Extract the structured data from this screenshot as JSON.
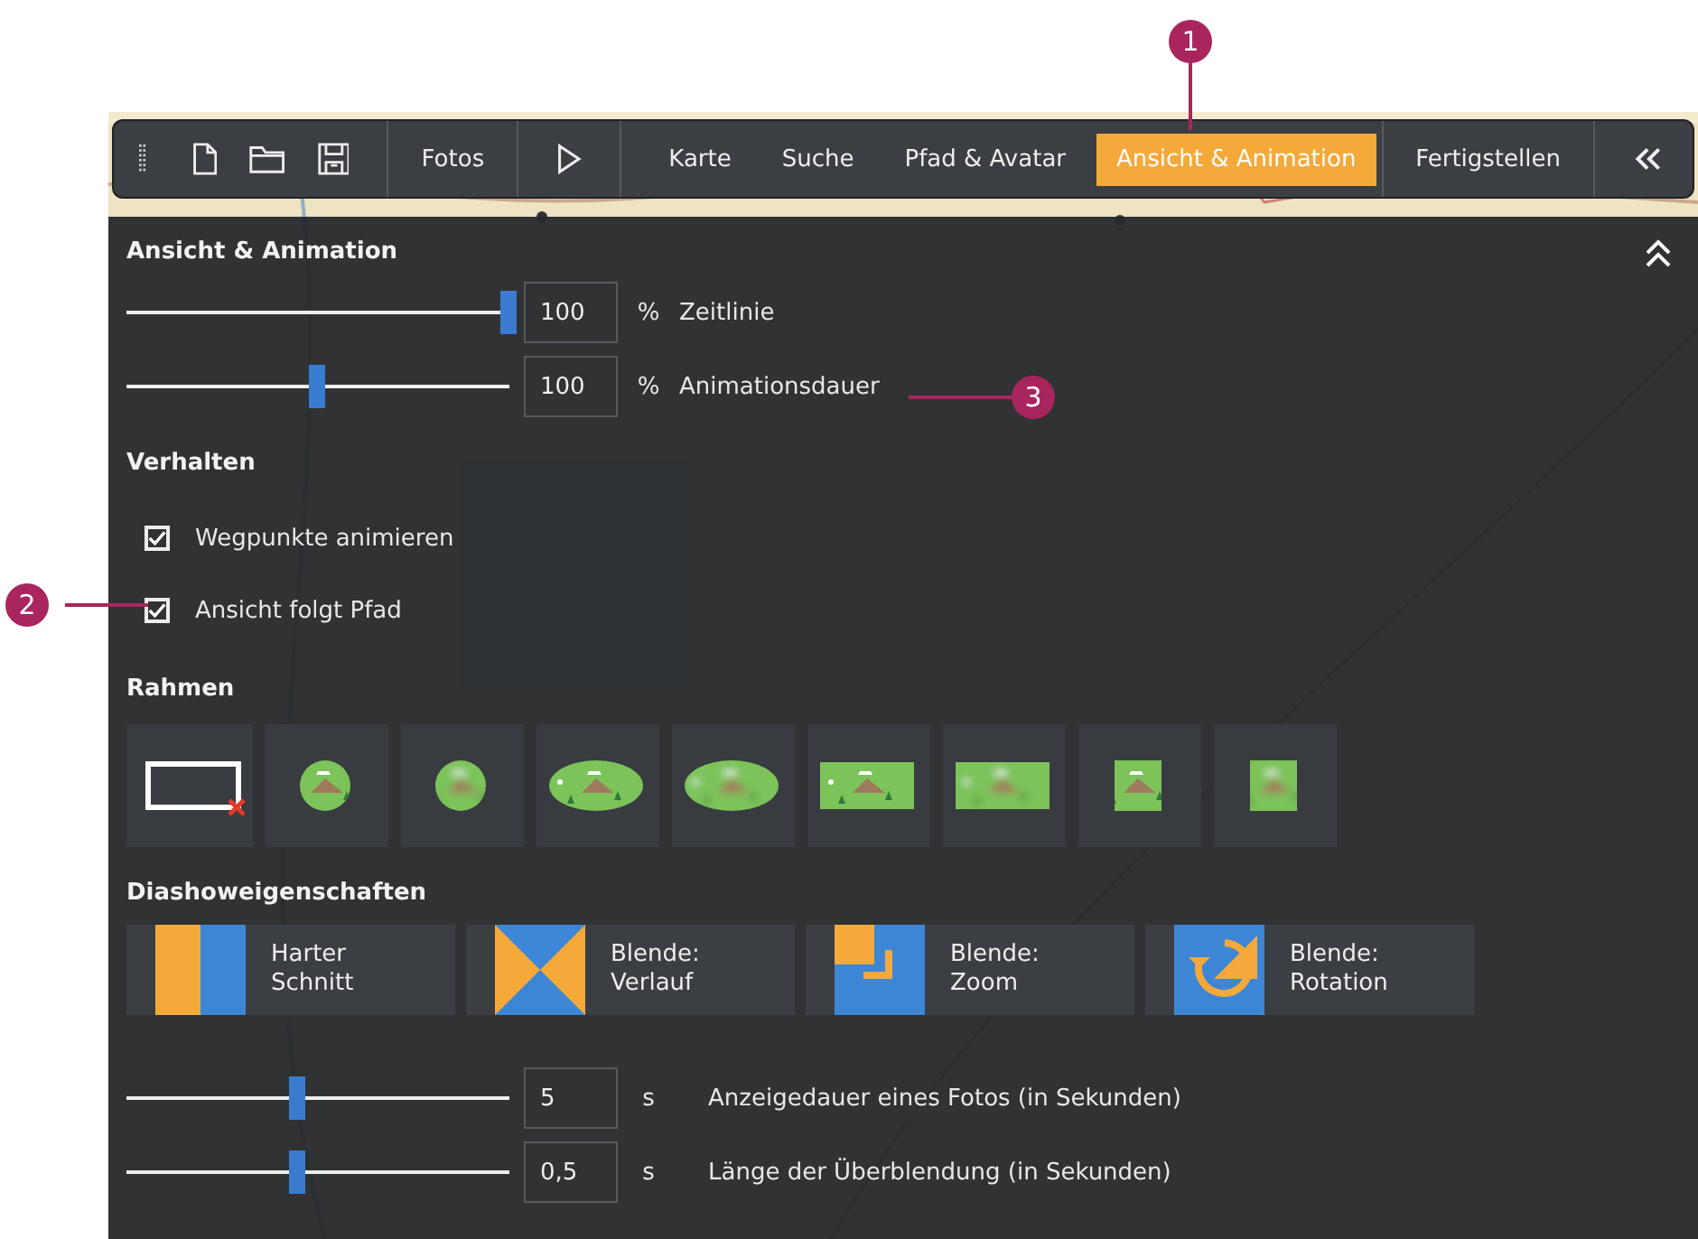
{
  "toolbar": {
    "file_buttons": [
      {
        "kind": "new"
      },
      {
        "kind": "open"
      },
      {
        "kind": "save"
      }
    ],
    "photos_label": "Fotos",
    "tabs": [
      {
        "label": "Karte",
        "selected": false
      },
      {
        "label": "Suche",
        "selected": false
      },
      {
        "label": "Pfad & Avatar",
        "selected": false
      },
      {
        "label": "Ansicht & Animation",
        "selected": true
      }
    ],
    "finish_label": "Fertigstellen"
  },
  "panel": {
    "title": "Ansicht & Animation",
    "view_sliders": [
      {
        "level": 1.0,
        "value": "100",
        "unit": "%",
        "label": "Zeitlinie"
      },
      {
        "level": 0.5,
        "value": "100",
        "unit": "%",
        "label": "Animationsdauer"
      }
    ],
    "behavior_title": "Verhalten",
    "options": [
      {
        "label": "Wegpunkte animieren",
        "checked": true
      },
      {
        "label": "Ansicht folgt Pfad",
        "checked": true
      }
    ],
    "frames_title": "Rahmen",
    "frames": [
      {
        "kind": "none"
      },
      {
        "kind": "circle"
      },
      {
        "kind": "circle-soft"
      },
      {
        "kind": "ellipse"
      },
      {
        "kind": "ellipse-soft"
      },
      {
        "kind": "rect"
      },
      {
        "kind": "rect-soft"
      },
      {
        "kind": "square"
      },
      {
        "kind": "square-soft"
      }
    ],
    "slideshow_title": "Diashoweigenschaften",
    "transitions": [
      {
        "kind": "cut",
        "label": "Harter\nSchnitt"
      },
      {
        "kind": "fade",
        "label": "Blende:\nVerlauf"
      },
      {
        "kind": "zoom",
        "label": "Blende:\nZoom"
      },
      {
        "kind": "rotate",
        "label": "Blende:\nRotation"
      }
    ],
    "slideshow_sliders": [
      {
        "level": 0.45,
        "value": "5",
        "unit": "s",
        "label": "Anzeigedauer eines Fotos (in Sekunden)"
      },
      {
        "level": 0.45,
        "value": "0,5",
        "unit": "s",
        "label": "Länge der Überblendung (in Sekunden)"
      }
    ]
  },
  "callouts": [
    {
      "kind": "tab",
      "number": "1"
    },
    {
      "kind": "checkbox",
      "number": "2"
    },
    {
      "kind": "label",
      "number": "3"
    }
  ]
}
